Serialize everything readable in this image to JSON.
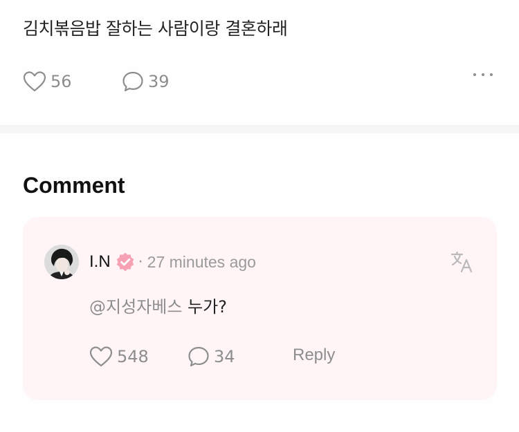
{
  "post": {
    "text": "김치볶음밥 잘하는 사람이랑 결혼하래",
    "likes": "56",
    "comments": "39"
  },
  "icons": {
    "like": "heart-icon",
    "comment": "speech-bubble-icon",
    "more": "more-horizontal-icon",
    "translate": "translate-icon",
    "verified": "verified-badge-icon"
  },
  "section": {
    "title": "Comment"
  },
  "comment": {
    "author": "I.N",
    "separator": "·",
    "time": "27 minutes ago",
    "mention": "@지성자베스",
    "body": " 누가?",
    "likes": "548",
    "replies": "34",
    "reply_label": "Reply"
  },
  "colors": {
    "card_background": "#fff5f6",
    "verified_badge": "#f7a1b5",
    "muted_text": "#8d8d8d"
  }
}
